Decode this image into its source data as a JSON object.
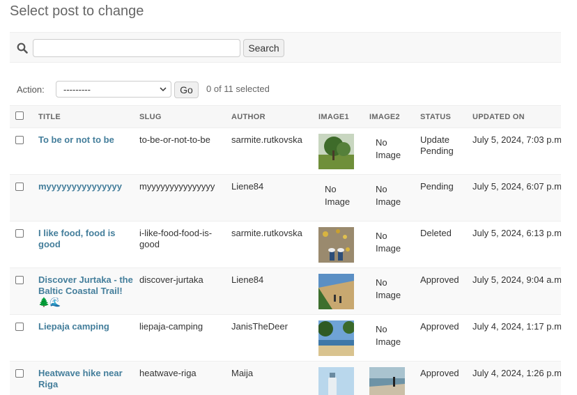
{
  "page": {
    "title": "Select post to change"
  },
  "search": {
    "value": "",
    "button_label": "Search"
  },
  "actions": {
    "label": "Action:",
    "selected_option": "---------",
    "go_label": "Go",
    "selected_count": "0 of 11 selected"
  },
  "table": {
    "headers": {
      "title": "TITLE",
      "slug": "SLUG",
      "author": "AUTHOR",
      "image1": "IMAGE1",
      "image2": "IMAGE2",
      "status": "STATUS",
      "updated": "UPDATED ON"
    },
    "rows": [
      {
        "title": "To be or not to be",
        "slug": "to-be-or-not-to-be",
        "author": "sarmite.rutkovska",
        "image1": "photo",
        "image2": "No Image",
        "status": "Update Pending",
        "updated": "July 5, 2024, 7:03 p.m."
      },
      {
        "title": "myyyyyyyyyyyyyyy",
        "slug": "myyyyyyyyyyyyyyy",
        "author": "Liene84",
        "image1": "No Image",
        "image2": "No Image",
        "status": "Pending",
        "updated": "July 5, 2024, 6:07 p.m."
      },
      {
        "title": "I like food, food is good",
        "slug": "i-like-food-food-is-good",
        "author": "sarmite.rutkovska",
        "image1": "photo",
        "image2": "No Image",
        "status": "Deleted",
        "updated": "July 5, 2024, 6:13 p.m."
      },
      {
        "title": "Discover Jurtaka - the Baltic Coastal Trail! 🌲🌊",
        "slug": "discover-jurtaka",
        "author": "Liene84",
        "image1": "photo",
        "image2": "No Image",
        "status": "Approved",
        "updated": "July 5, 2024, 9:04 a.m."
      },
      {
        "title": "Liepaja camping",
        "slug": "liepaja-camping",
        "author": "JanisTheDeer",
        "image1": "photo",
        "image2": "No Image",
        "status": "Approved",
        "updated": "July 4, 2024, 1:17 p.m."
      },
      {
        "title": "Heatwave hike near Riga",
        "slug": "heatwave-riga",
        "author": "Maija",
        "image1": "photo",
        "image2": "photo",
        "status": "Approved",
        "updated": "July 4, 2024, 1:26 p.m."
      }
    ]
  },
  "colors": {
    "link": "#447e9b",
    "header_bg": "#f7f7f7"
  }
}
